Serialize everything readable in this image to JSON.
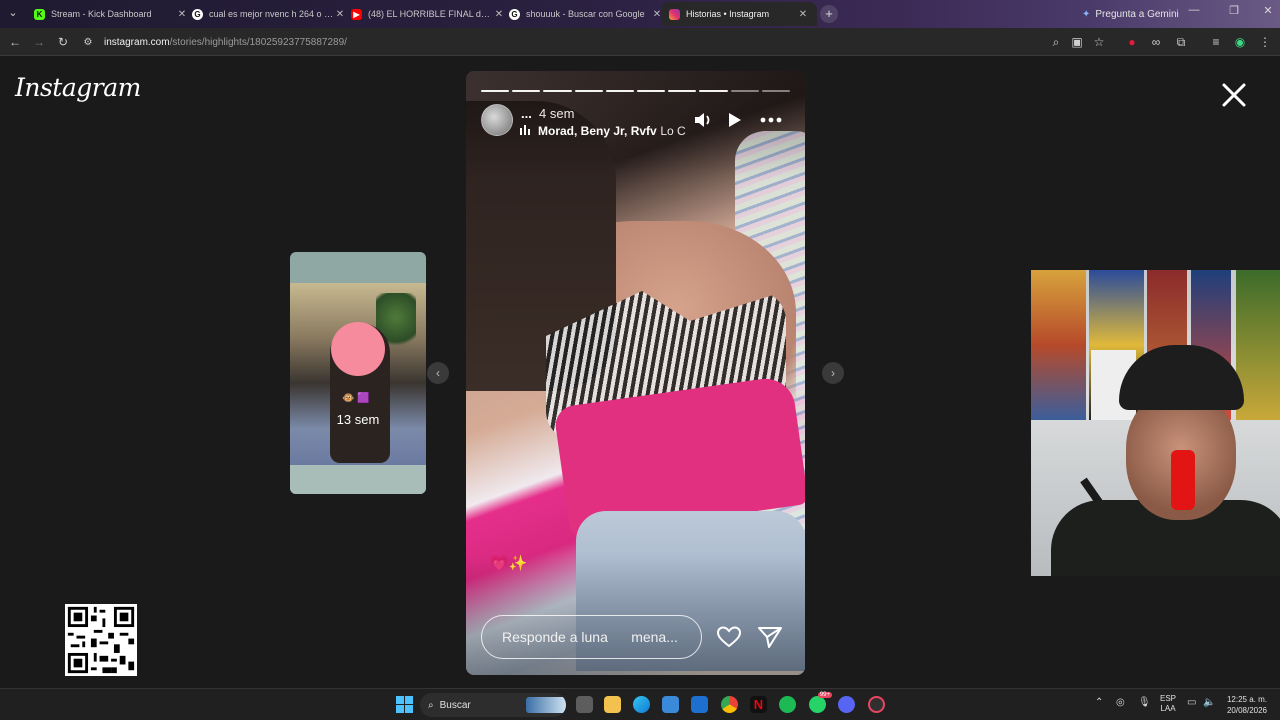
{
  "browser": {
    "tabs": [
      {
        "title": "Stream - Kick Dashboard",
        "favicon": "kick-icon",
        "favicon_color": "#53fc18",
        "active": false
      },
      {
        "title": "cual es mejor nvenc h 264 o nv...",
        "favicon": "google-icon",
        "favicon_color": "#ffffff",
        "active": false
      },
      {
        "title": "(48) EL HORRIBLE FINAL de ALG...",
        "favicon": "youtube-icon",
        "favicon_color": "#ff0000",
        "active": false
      },
      {
        "title": "shouuuk - Buscar con Google",
        "favicon": "google-icon",
        "favicon_color": "#ffffff",
        "active": false
      },
      {
        "title": "Historias • Instagram",
        "favicon": "instagram-icon",
        "favicon_color": "#e1306c",
        "active": true
      }
    ],
    "gemini_label": "Pregunta a Gemini",
    "url_host": "instagram.com",
    "url_path": "/stories/highlights/18025923775887289/"
  },
  "instagram": {
    "logo_text": "Instagram",
    "prev_story": {
      "age": "13 sem",
      "emojis": "🐵 🟪"
    },
    "story": {
      "progress_segments": 10,
      "progress_done": 8,
      "username": "...",
      "time": "4 sem",
      "music_artists": "Morad, Beny Jr, Rvfv",
      "music_track": " · Lo C",
      "sticker": "💗✨",
      "reply_placeholder": "Responde a luna      mena..."
    }
  },
  "taskbar": {
    "search_label": "Buscar",
    "lang_top": "ESP",
    "lang_bottom": "LAA",
    "time": "12:25 a. m.",
    "date": "20/08/2026",
    "whatsapp_badge": "99+"
  }
}
